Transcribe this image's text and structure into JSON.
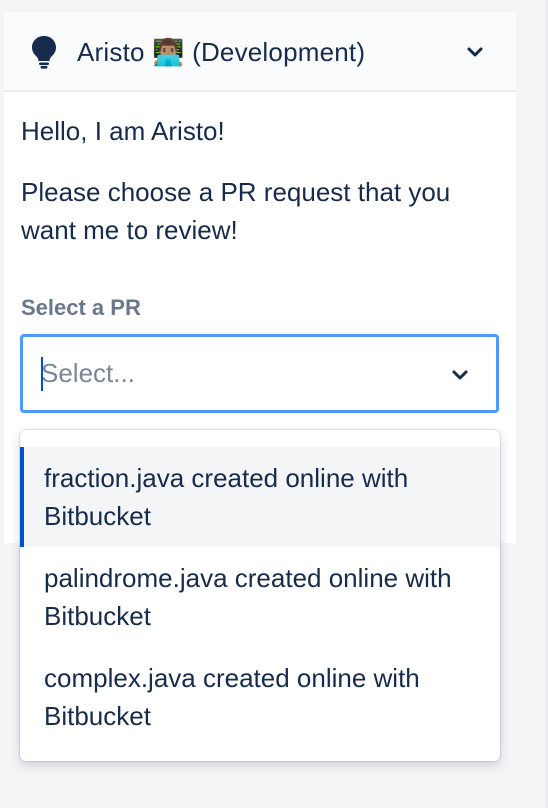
{
  "header": {
    "icon": "lightbulb-icon",
    "title": "Aristo 👨🏽‍💻 (Development)",
    "chevron_icon": "chevron-down-icon"
  },
  "content": {
    "greeting": "Hello, I am Aristo!",
    "prompt": "Please choose a PR request that you want me to review!"
  },
  "pr_select": {
    "label": "Select a PR",
    "placeholder": "Select...",
    "chevron_icon": "chevron-down-icon",
    "options": [
      {
        "label": "fraction.java created online with Bitbucket",
        "focused": true
      },
      {
        "label": "palindrome.java created online with Bitbucket",
        "focused": false
      },
      {
        "label": "complex.java created online with Bitbucket",
        "focused": false
      }
    ]
  },
  "colors": {
    "text": "#172b4d",
    "label": "#6b778c",
    "focus_border": "#4c9aff",
    "option_focus_bar": "#0052cc",
    "option_focus_bg": "#f4f5f7"
  }
}
